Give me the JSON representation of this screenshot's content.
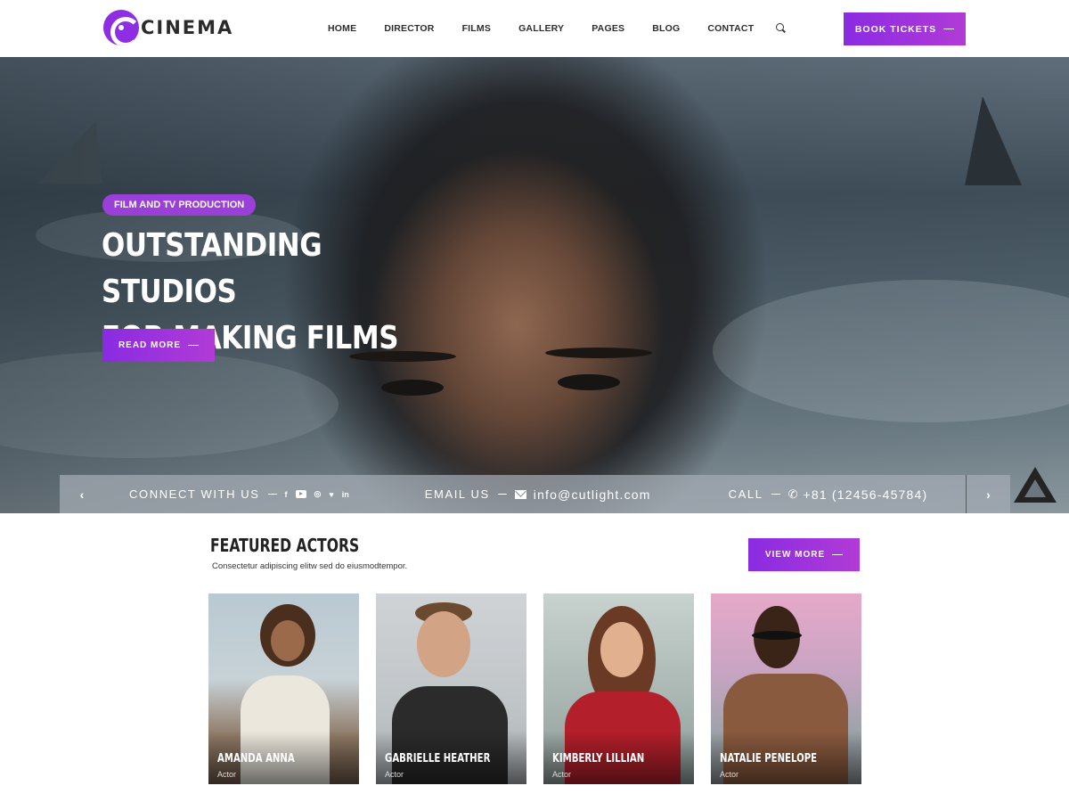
{
  "brand": {
    "name": "CINEMA"
  },
  "nav": {
    "items": [
      "HOME",
      "DIRECTOR",
      "FILMS",
      "GALLERY",
      "PAGES",
      "BLOG",
      "CONTACT"
    ],
    "search_icon": "search-icon"
  },
  "header": {
    "book_label": "BOOK TICKETS"
  },
  "hero": {
    "badge": "FILM AND TV PRODUCTION",
    "title_line1": "OUTSTANDING STUDIOS",
    "title_line2": "FOR MAKING FILMS",
    "read_more": "READ MORE"
  },
  "info_bar": {
    "prev_arrow": "‹",
    "next_arrow": "›",
    "connect_label": "CONNECT WITH US",
    "social_icons": [
      "facebook-icon",
      "youtube-icon",
      "instagram-icon",
      "twitter-icon",
      "linkedin-icon"
    ],
    "email_label": "EMAIL US",
    "email_value": "info@cutlight.com",
    "call_label": "CALL",
    "phone_value": "+81 (12456-45784)"
  },
  "featured": {
    "title": "FEATURED ACTORS",
    "subtitle": "Consectetur adipiscing elitw sed do eiusmodtempor.",
    "view_more": "VIEW MORE",
    "actors": [
      {
        "name": "AMANDA ANNA",
        "role": "Actor"
      },
      {
        "name": "GABRIELLE HEATHER",
        "role": "Actor"
      },
      {
        "name": "KIMBERLY LILLIAN",
        "role": "Actor"
      },
      {
        "name": "NATALIE PENELOPE",
        "role": "Actor"
      }
    ]
  },
  "colors": {
    "accent_start": "#8a2be2",
    "accent_end": "#b13bd6",
    "badge": "#9b3fd9"
  }
}
